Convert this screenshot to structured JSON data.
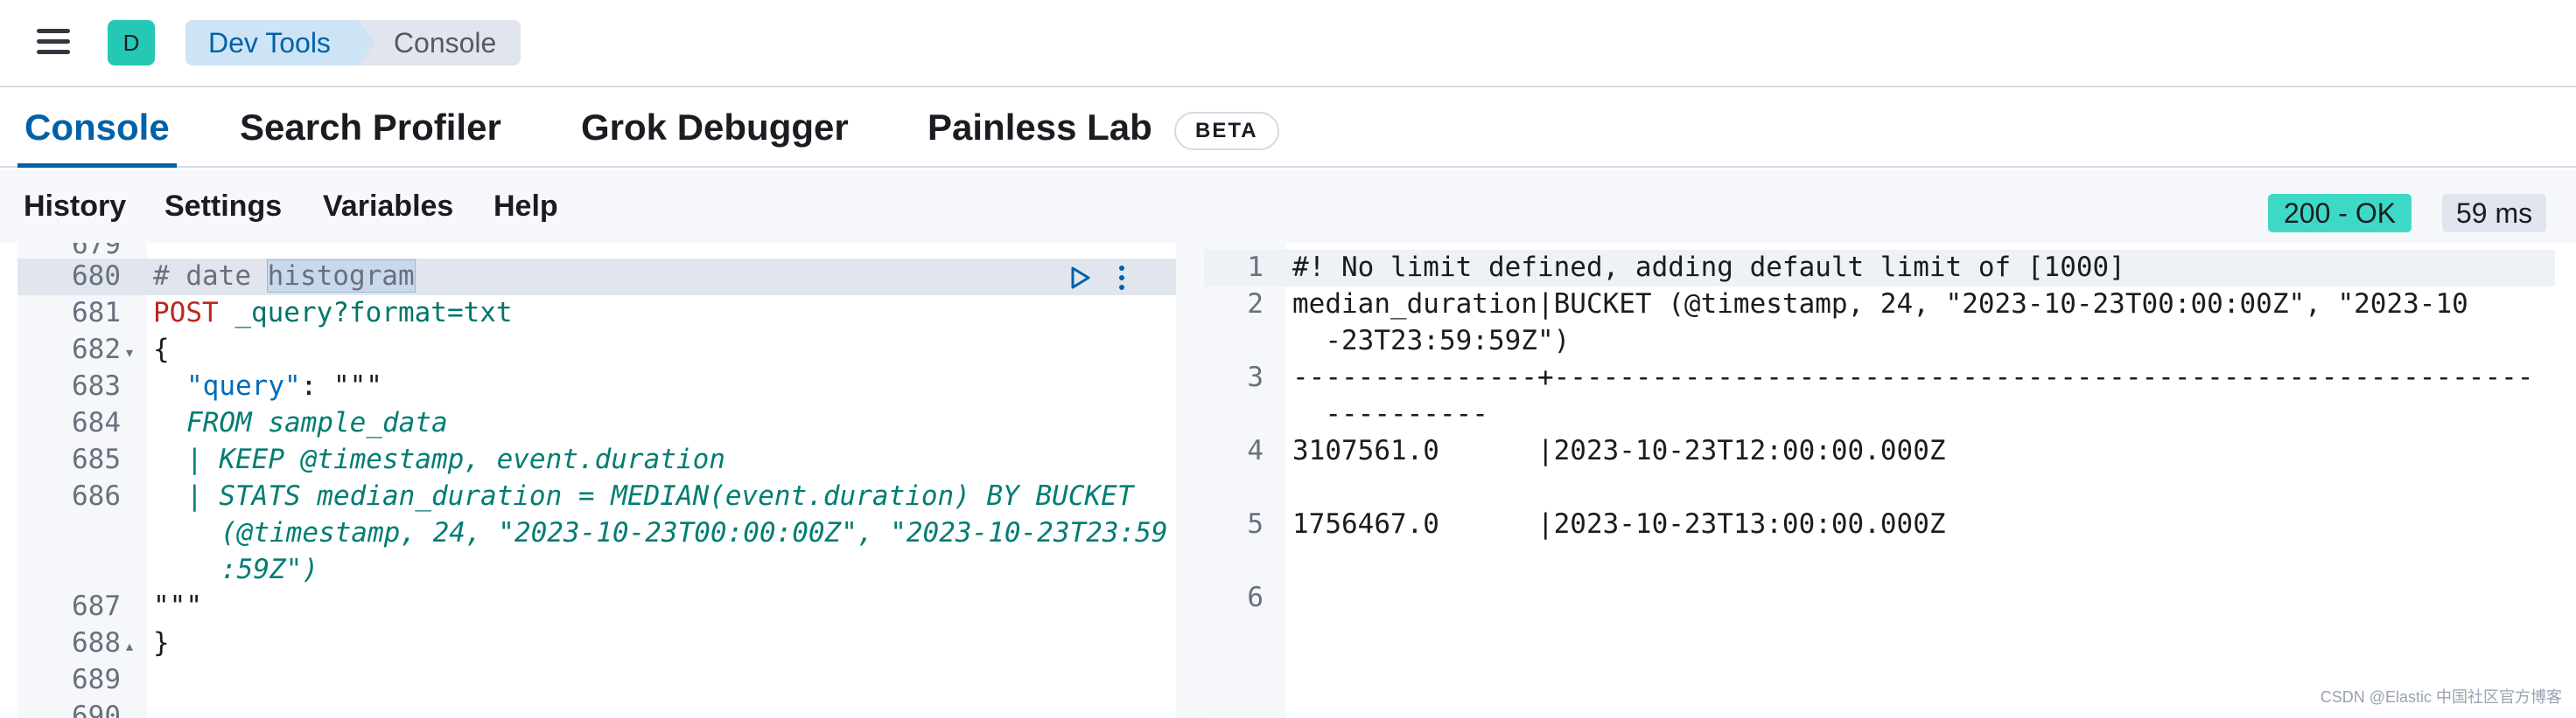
{
  "header": {
    "avatar_initial": "D",
    "breadcrumbs": [
      "Dev Tools",
      "Console"
    ]
  },
  "tabs": [
    {
      "label": "Console",
      "active": true
    },
    {
      "label": "Search Profiler",
      "active": false
    },
    {
      "label": "Grok Debugger",
      "active": false
    },
    {
      "label": "Painless Lab",
      "active": false
    }
  ],
  "beta_badge": "BETA",
  "toolbar": {
    "items": [
      "History",
      "Settings",
      "Variables",
      "Help"
    ],
    "status": "200 - OK",
    "time": "59 ms"
  },
  "request_editor": {
    "partial_top_line": "679",
    "lines": [
      {
        "num": "680",
        "fold": "",
        "active": true
      },
      {
        "num": "681",
        "fold": ""
      },
      {
        "num": "682",
        "fold": "▾"
      },
      {
        "num": "683",
        "fold": ""
      },
      {
        "num": "684",
        "fold": ""
      },
      {
        "num": "685",
        "fold": ""
      },
      {
        "num": "686",
        "fold": ""
      },
      {
        "num": "687",
        "fold": ""
      },
      {
        "num": "688",
        "fold": "▴"
      },
      {
        "num": "689",
        "fold": ""
      },
      {
        "num": "690",
        "fold": ""
      }
    ],
    "code": {
      "comment_prefix": "# date ",
      "comment_selected": "histogram",
      "method": "POST",
      "url": " _query?format=txt",
      "open_brace": "{",
      "query_key": "\"query\"",
      "colon": ": ",
      "triple_quote_open": "\"\"\"",
      "from_line": "FROM sample_data",
      "keep_line": "| KEEP @timestamp, event.duration",
      "stats_line_1": "| STATS median_duration = MEDIAN(event.duration) BY BUCKET",
      "stats_line_2": "(@timestamp, 24, \"2023-10-23T00:00:00Z\", \"2023-10-23T23:59",
      "stats_line_3": ":59Z\")",
      "triple_quote_close": "\"\"\"",
      "close_brace": "}"
    }
  },
  "response_editor": {
    "line_numbers": [
      "1",
      "2",
      "3",
      "4",
      "5",
      "6"
    ],
    "lines": [
      "#! No limit defined, adding default limit of [1000]",
      "median_duration|BUCKET (@timestamp, 24, \"2023-10-23T00:00:00Z\", \"2023-10",
      "  -23T23:59:59Z\")",
      "---------------+------------------------------------------------------------",
      "  ----------",
      "3107561.0      |2023-10-23T12:00:00.000Z",
      "1756467.0      |2023-10-23T13:00:00.000Z"
    ]
  },
  "watermark": "CSDN @Elastic 中国社区官方博客",
  "colors": {
    "accent": "#0061a6",
    "status_ok": "#3ed9c6",
    "avatar": "#25c8b4"
  }
}
